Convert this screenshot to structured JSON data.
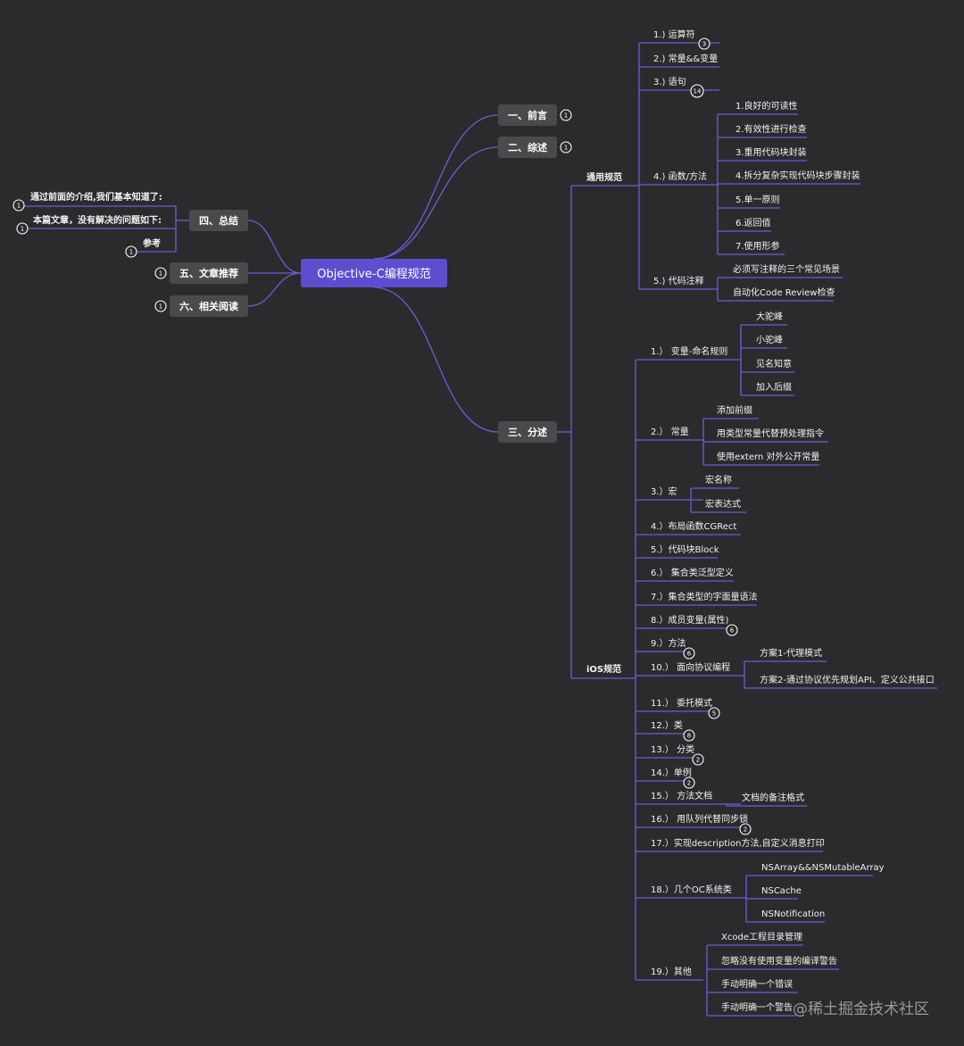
{
  "root": {
    "label": "Objective-C编程规范"
  },
  "main": {
    "preface": {
      "label": "一、前言",
      "badge": "1"
    },
    "overview": {
      "label": "二、综述",
      "badge": "1"
    },
    "details": {
      "label": "三、分述"
    },
    "summary": {
      "label": "四、总结"
    },
    "recommend": {
      "label": "五、文章推荐",
      "badge": "1"
    },
    "related": {
      "label": "六、相关阅读",
      "badge": "1"
    }
  },
  "summary_items": [
    {
      "label": "通过前面的介绍,我们基本知道了:",
      "badge": "1"
    },
    {
      "label": "本篇文章，没有解决的问题如下:",
      "badge": "1"
    },
    {
      "label": "参考",
      "badge": "1"
    }
  ],
  "general": {
    "label": "通用规范",
    "items": [
      {
        "label": "1.) 运算符",
        "badge": "3"
      },
      {
        "label": "2.) 常量&&变量"
      },
      {
        "label": "3.) 语句",
        "badge": "14"
      },
      {
        "label": "4.) 函数/方法",
        "children": [
          "1.良好的可读性",
          "2.有效性进行检查",
          "3.重用代码块封装",
          "4.拆分复杂实现代码块步骤封装",
          "5.单一原则",
          "6.返回值",
          "7.使用形参"
        ]
      },
      {
        "label": "5.) 代码注释",
        "children": [
          "必须写注释的三个常见场景",
          "自动化Code Review检查"
        ]
      }
    ]
  },
  "ios": {
    "label": "iOS规范",
    "items": [
      {
        "label": "1.）  变量-命名规则",
        "children": [
          "大驼峰",
          "小驼峰",
          "见名知意",
          "加入后缀"
        ]
      },
      {
        "label": "2.）  常量",
        "children": [
          "添加前缀",
          "用类型常量代替预处理指令",
          "使用extern 对外公开常量"
        ]
      },
      {
        "label": "3.）宏",
        "children": [
          "宏名称",
          "宏表达式"
        ]
      },
      {
        "label": "4.）布局函数CGRect"
      },
      {
        "label": "5.）代码块Block"
      },
      {
        "label": "6.）  集合类泛型定义"
      },
      {
        "label": "7.）集合类型的字面量语法"
      },
      {
        "label": "8.）成员变量(属性)",
        "badge": "6"
      },
      {
        "label": "9.）方法",
        "badge": "6"
      },
      {
        "label": "10.）  面向协议编程",
        "children": [
          "方案1-代理模式",
          "方案2-通过协议优先规划API、定义公共接口"
        ]
      },
      {
        "label": "11.）  委托模式",
        "badge": "5"
      },
      {
        "label": "12.）类",
        "badge": "8"
      },
      {
        "label": "13.）  分类",
        "badge": "2"
      },
      {
        "label": "14.）单例",
        "badge": "2"
      },
      {
        "label": "15.）  方法文档",
        "children": [
          "文档的备注格式"
        ]
      },
      {
        "label": "16.）  用队列代替同步锁",
        "badge": "2"
      },
      {
        "label": "17.）实现description方法,自定义消息打印"
      },
      {
        "label": "18.）几个OC系统类",
        "children": [
          "NSArray&&NSMutableArray",
          "NSCache",
          "NSNotification"
        ]
      },
      {
        "label": "19.）其他",
        "children": [
          "Xcode工程目录管理",
          "忽略没有使用变量的编译警告",
          "手动明确一个错误",
          "手动明确一个警告"
        ]
      }
    ]
  },
  "watermark": "@稀土掘金技术社区",
  "colors": {
    "background": "#2b2b2d",
    "line": "#6a5ed6",
    "root": "#5b4fd0",
    "node": "#4a4a4c"
  }
}
